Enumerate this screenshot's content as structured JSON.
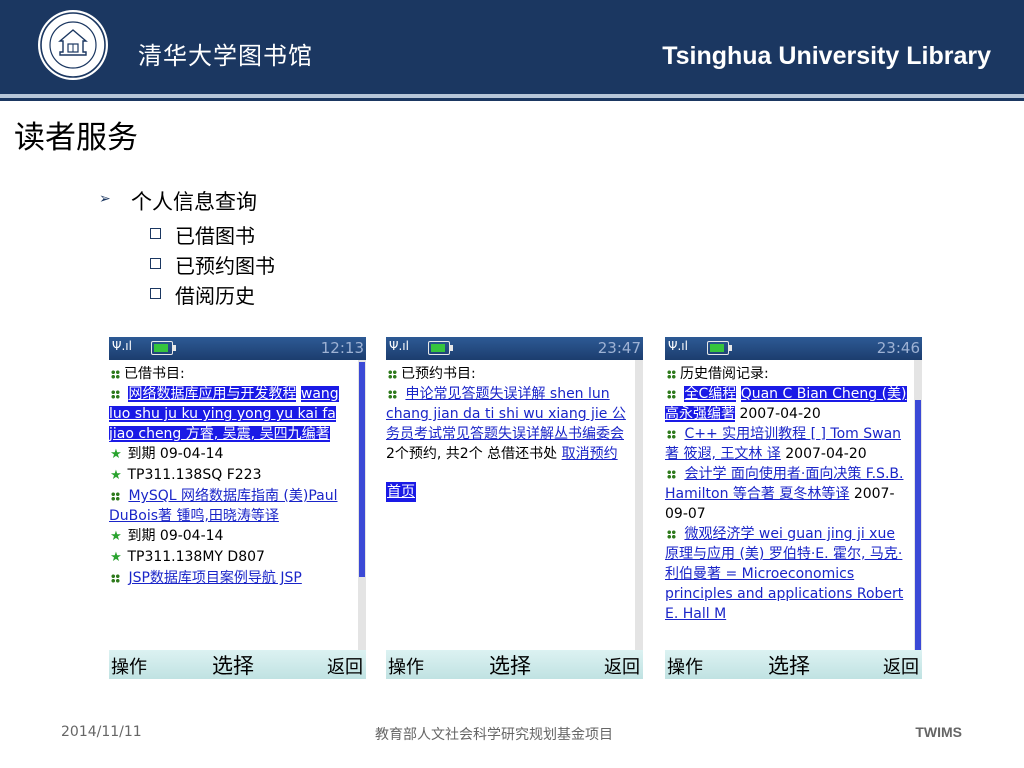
{
  "header": {
    "logo_name": "tsinghua-seal-icon",
    "logo_text": "TSINGHUA UNIVERSITY 清华大学 1911",
    "title_cn": "清华大学图书馆",
    "title_en": "Tsinghua University Library"
  },
  "slide": {
    "title": "读者服务",
    "bullet": "个人信息查询",
    "subitems": [
      "已借图书",
      "已预约图书",
      "借阅历史"
    ]
  },
  "phones": [
    {
      "time": "12:13",
      "heading": "已借书目:",
      "book1": "网络数据库应用与开发教程",
      "book1_author": "wang luo shu ju ku ying yong yu kai fa jiao cheng 方睿, 吴震, 吴四九编著",
      "due_label": "到期",
      "due1": "09-04-14",
      "call1": "TP311.138SQ F223",
      "book2": "MySQL 网络数据库指南 (美)Paul DuBois著 锺鸣,田晓涛等译",
      "due2": "09-04-14",
      "call2": "TP311.138MY D807",
      "book3": "JSP数据库项目案例导航 JSP"
    },
    {
      "time": "23:47",
      "heading": "已预约书目:",
      "book1": "申论常见答题失误详解 shen lun chang jian da ti shi wu xiang jie 公务员考试常见答题失误详解丛书编委会",
      "status": "2个预约, 共2个 总借还书处",
      "cancel": "取消预约",
      "home": "首页"
    },
    {
      "time": "23:46",
      "heading": "历史借阅记录:",
      "book1": "全C编程",
      "book1_rest": "Quan C Bian Cheng (美) 高永强编著",
      "date1": "2007-04-20",
      "book2": "C++ 实用培训教程 [ ] Tom Swan 著 筱遐, 王文林 译",
      "date2": "2007-04-20",
      "book3": "会计学 面向使用者·面向决策 F.S.B. Hamilton 等合著 夏冬林等译",
      "date3": "2007-09-07",
      "book4": "微观经济学 wei guan jing ji xue 原理与应用 (美) 罗伯特·E. 霍尔, 马克·利伯曼著 = Microeconomics principles and applications Robert E. Hall M"
    }
  ],
  "softkeys": {
    "left": "操作",
    "center": "选择",
    "right": "返回"
  },
  "footer": {
    "date": "2014/11/11",
    "center": "教育部人文社会科学研究规划基金项目",
    "right": "TWIMS"
  },
  "colors": {
    "header_bg": "#1b3761",
    "link": "#1a25c8",
    "highlight": "#1a1ae6",
    "softkey_bg": "#c8e8e8"
  }
}
